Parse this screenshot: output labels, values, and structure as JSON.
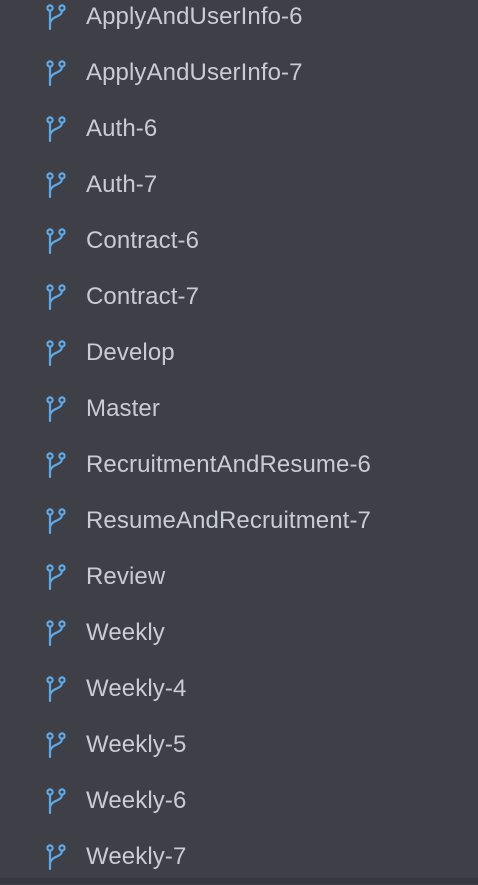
{
  "branches": [
    {
      "label": "ApplyAndUserInfo-6"
    },
    {
      "label": "ApplyAndUserInfo-7"
    },
    {
      "label": "Auth-6"
    },
    {
      "label": "Auth-7"
    },
    {
      "label": "Contract-6"
    },
    {
      "label": "Contract-7"
    },
    {
      "label": "Develop"
    },
    {
      "label": "Master"
    },
    {
      "label": "RecruitmentAndResume-6"
    },
    {
      "label": "ResumeAndRecruitment-7"
    },
    {
      "label": "Review"
    },
    {
      "label": "Weekly"
    },
    {
      "label": "Weekly-4"
    },
    {
      "label": "Weekly-5"
    },
    {
      "label": "Weekly-6"
    },
    {
      "label": "Weekly-7"
    }
  ],
  "icon": "git-branch-icon",
  "colors": {
    "background": "#3e3f47",
    "text": "#c9ccd3",
    "icon": "#5ea8e6"
  }
}
